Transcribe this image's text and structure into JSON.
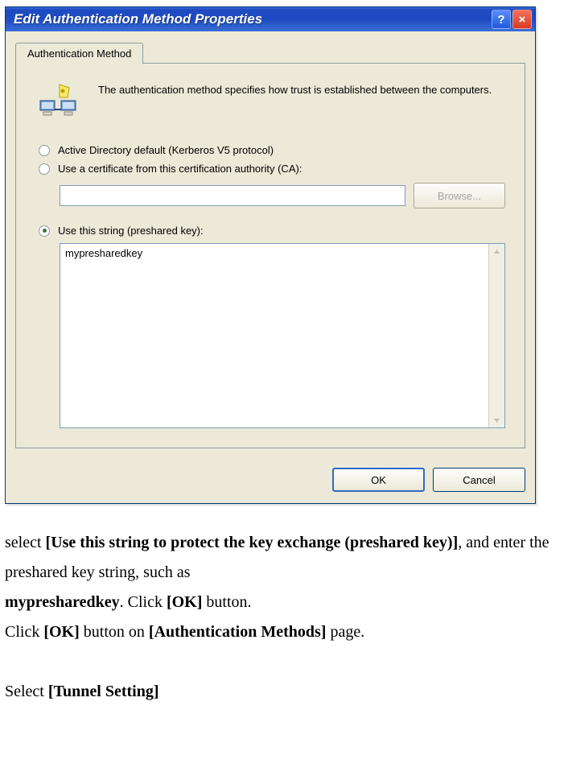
{
  "dialog": {
    "title": "Edit Authentication Method Properties",
    "tab_label": "Authentication Method",
    "intro_text": "The authentication method specifies how trust is established between the computers.",
    "radio1": "Active Directory default (Kerberos V5 protocol)",
    "radio2": "Use a certificate from this certification authority (CA):",
    "radio3": "Use this string (preshared key):",
    "browse_label": "Browse...",
    "textarea_value": "mypresharedkey",
    "ok_label": "OK",
    "cancel_label": "Cancel",
    "help_label": "?",
    "close_label": "×"
  },
  "doc": {
    "p1a": "select ",
    "p1b": "[Use this string to protect the key exchange (preshared key)]",
    "p1c": ", and enter the preshared key string, such as",
    "p2a": "mypresharedkey",
    "p2b": ". Click ",
    "p2c": "[OK]",
    "p2d": " button.",
    "p3a": "Click ",
    "p3b": "[OK]",
    "p3c": " button on ",
    "p3d": "[Authentication Methods]",
    "p3e": " page.",
    "p4a": "Select ",
    "p4b": "[Tunnel Setting]"
  }
}
